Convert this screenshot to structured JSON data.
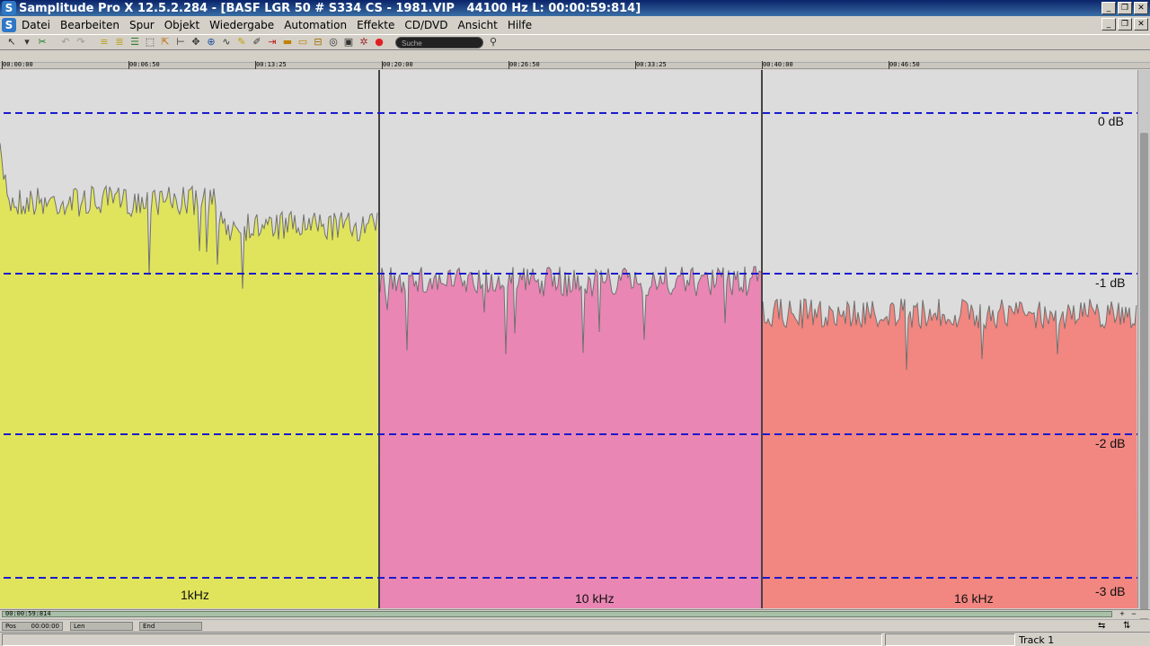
{
  "window": {
    "title": "Samplitude Pro X 12.5.2.284 - [BASF LGR 50 # S334 CS - 1981.VIP   44100 Hz L: 00:00:59:814]",
    "app_icon_letter": "S"
  },
  "menu": {
    "items": [
      "Datei",
      "Bearbeiten",
      "Spur",
      "Objekt",
      "Wiedergabe",
      "Automation",
      "Effekte",
      "CD/DVD",
      "Ansicht",
      "Hilfe"
    ]
  },
  "toolbar": {
    "search_placeholder": "Suche"
  },
  "ruler": {
    "labels": [
      "00:00:00",
      "00:06:50",
      "00:13:25",
      "00:20:00",
      "00:26:50",
      "00:33:25",
      "00:40:00",
      "00:46:50"
    ]
  },
  "db_scale": {
    "labels": [
      "0 dB",
      "-1 dB",
      "-2 dB",
      "-3 dB"
    ]
  },
  "segments": [
    {
      "label": "1kHz",
      "color": "#e0e45c",
      "level_db": -0.55
    },
    {
      "label": "10 kHz",
      "color": "#e986b4",
      "level_db": -1.05
    },
    {
      "label": "16 kHz",
      "color": "#f28680",
      "level_db": -1.25
    }
  ],
  "colors": {
    "grid_line": "#1a1acc",
    "waveform_outline": "#707070",
    "background": "#dcdcdc"
  },
  "scroll": {
    "position_text": "00:00:59:814"
  },
  "position_bar": {
    "pos_label": "Pos",
    "pos_value": "00:00:00",
    "len_label": "Len",
    "end_label": "End"
  },
  "status": {
    "track_label": "Track 1"
  }
}
